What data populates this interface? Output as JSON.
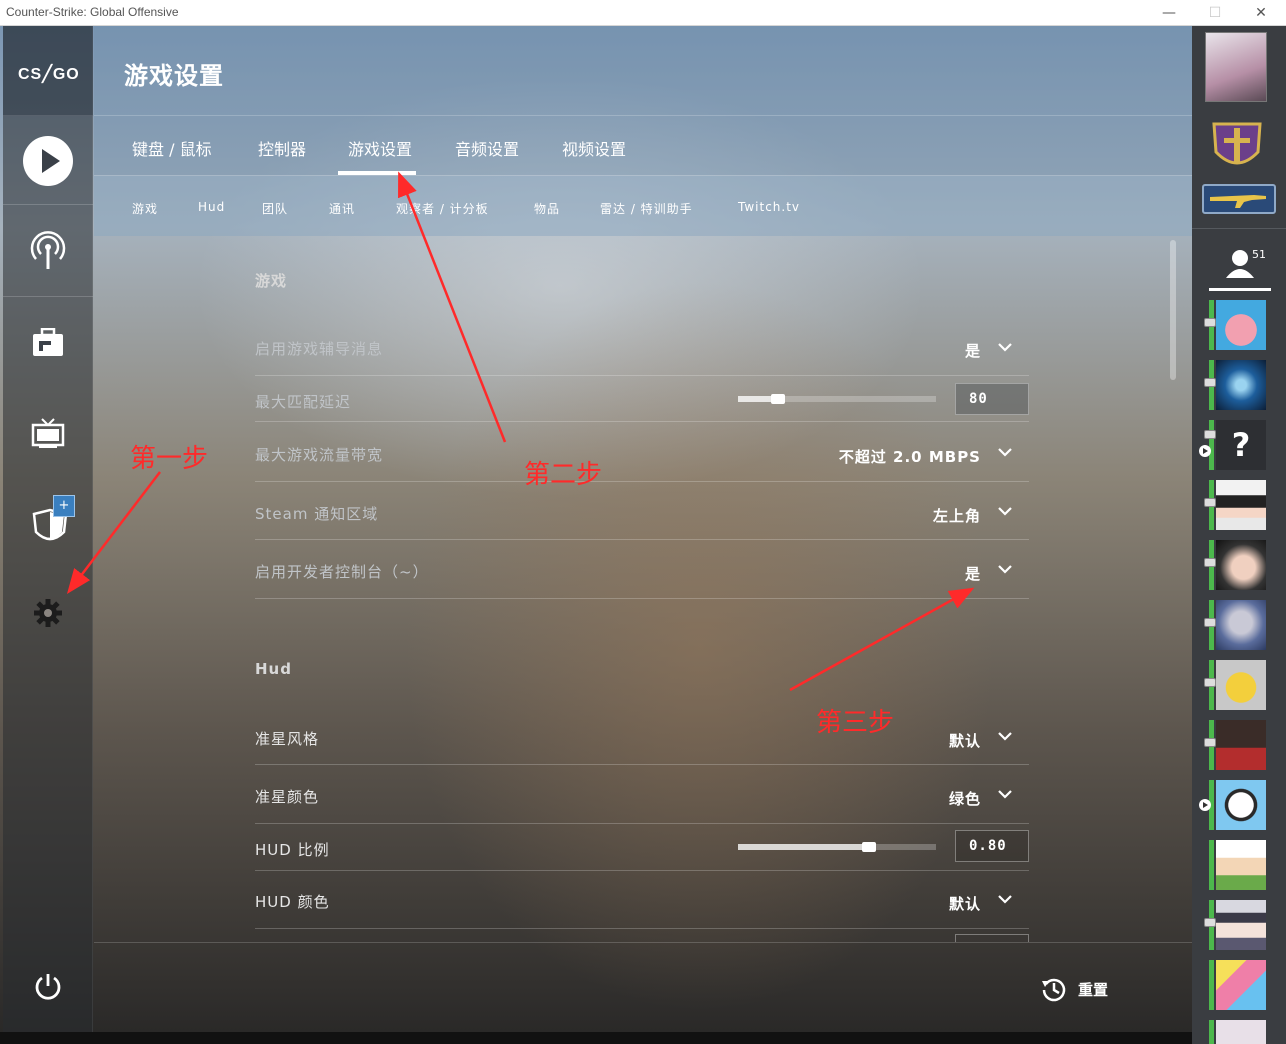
{
  "window": {
    "title": "Counter-Strike: Global Offensive",
    "minimize": "—",
    "maximize": "☐",
    "close": "✕"
  },
  "nav": {
    "logo": "CS╱GO",
    "items": [
      "play-icon",
      "broadcast-icon",
      "inventory-icon",
      "watch-icon",
      "profile-icon",
      "settings-icon",
      "power-icon"
    ],
    "profile_badge": "+"
  },
  "header": {
    "page_title": "游戏设置",
    "tabs": [
      "键盘 / 鼠标",
      "控制器",
      "游戏设置",
      "音频设置",
      "视频设置"
    ],
    "active_tab": "游戏设置",
    "subtabs": [
      "游戏",
      "Hud",
      "团队",
      "通讯",
      "观察者 / 计分板",
      "物品",
      "雷达 / 特训助手",
      "Twitch.tv"
    ]
  },
  "sections": {
    "game": {
      "title": "游戏",
      "rows": [
        {
          "label": "启用游戏辅导消息",
          "value": "是"
        },
        {
          "label": "最大匹配延迟",
          "value": "80",
          "slider_fraction": 0.2
        },
        {
          "label": "最大游戏流量带宽",
          "value": "不超过 2.0 MBPS"
        },
        {
          "label": "Steam 通知区域",
          "value": "左上角"
        },
        {
          "label": "启用开发者控制台（~）",
          "value": "是"
        }
      ]
    },
    "hud": {
      "title": "Hud",
      "rows": [
        {
          "label": "准星风格",
          "value": "默认"
        },
        {
          "label": "准星颜色",
          "value": "绿色"
        },
        {
          "label": "HUD 比例",
          "value": "0.80",
          "slider_fraction": 0.66
        },
        {
          "label": "HUD 颜色",
          "value": "默认"
        }
      ]
    }
  },
  "footer": {
    "reset_label": "重置"
  },
  "annotations": {
    "step1": "第一步",
    "step2": "第二步",
    "step3": "第三步"
  },
  "friends": {
    "online_count": "51",
    "avatars": [
      "pink-starfish",
      "blue-crystal",
      "question-mark",
      "anime-boy",
      "woman-portrait",
      "man-portrait",
      "yellow-cartoon",
      "man-red-shirt",
      "panda-cartoon",
      "anime-girl-white",
      "anime-girl-cat",
      "anime-girl-yellow"
    ]
  },
  "colors": {
    "annotation": "#ff2a2a",
    "online_status": "#4cb84c",
    "panel": "#3a3d41"
  }
}
